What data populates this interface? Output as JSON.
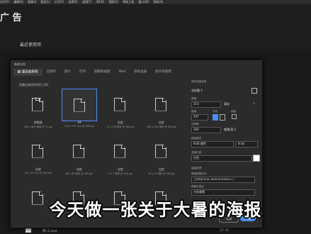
{
  "menu": [
    "文件(F)",
    "编辑(E)",
    "图像(I)",
    "图层(L)",
    "文字(Y)",
    "选择(S)",
    "滤镜(T)",
    "3D(D)",
    "视图(V)",
    "增效工具",
    "窗口(W)",
    "帮助(H)"
  ],
  "app_title": "广 告",
  "recent_heading": "最近使用项",
  "dialog": {
    "title": "新建文档",
    "tabs": [
      "最近使用项",
      "已保存",
      "照片",
      "打印",
      "图稿和插图",
      "Web",
      "移动设备",
      "胶片和视频"
    ],
    "section_label": "您最近使用的项目 (26)",
    "cards": [
      {
        "name": "剪贴板",
        "size": "100 x 667 像素 @ 72 ppi",
        "icon": "clipboard"
      },
      {
        "name": "A4",
        "size": "210 x 297 mm @ 300 ppi",
        "icon": "doc"
      },
      {
        "name": "自定",
        "size": "21 x 9.8 毫米 @ 300 ppi",
        "icon": "doc"
      },
      {
        "name": "自定",
        "size": "100 x 100 毫米 @ 300 ppi",
        "icon": "doc"
      },
      {
        "name": "自定",
        "size": "40 x 40 mm @ 300 ppi",
        "icon": "doc"
      },
      {
        "name": "自定",
        "size": "60 x 60 毫米 @ 300 ppi",
        "icon": "doc"
      },
      {
        "name": "自定",
        "size": "5 x 5 毫米 @ 300 ppi",
        "icon": "doc"
      },
      {
        "name": "自定",
        "size": "15 x 15 毫米 @ 300 ppi",
        "icon": "doc"
      },
      {
        "name": "",
        "size": "",
        "icon": "doc"
      },
      {
        "name": "",
        "size": "",
        "icon": "doc"
      },
      {
        "name": "",
        "size": "",
        "icon": "doc"
      },
      {
        "name": "",
        "size": "",
        "icon": "doc"
      }
    ],
    "panel": {
      "header": "预设详细信息",
      "name": "未标题-1",
      "width_label": "宽度",
      "width_value": "210",
      "width_unit": "毫米",
      "height_label": "高度",
      "height_value": "297",
      "orientation_label": "方向",
      "artboard_label": "画板",
      "resolution_label": "分辨率",
      "resolution_value": "300",
      "resolution_unit": "像素/英寸",
      "color_mode_label": "颜色模式",
      "color_mode_value": "RGB 颜色",
      "bit_depth": "8 bit",
      "bg_label": "背景内容",
      "bg_value": "白色",
      "advanced_label": "高级选项",
      "profile_label": "颜色配置文件",
      "profile_value": "工作中的 RGB: sRGB IEC61966-2.1",
      "pixel_ratio_label": "像素长宽比",
      "pixel_ratio_value": "方形像素"
    },
    "close_label": "关闭",
    "create_label": "创建"
  },
  "bottom": {
    "file_name": "精 Z.psd",
    "file_size": "37 M"
  },
  "subtitle": "今天做一张关于大暑的海报"
}
